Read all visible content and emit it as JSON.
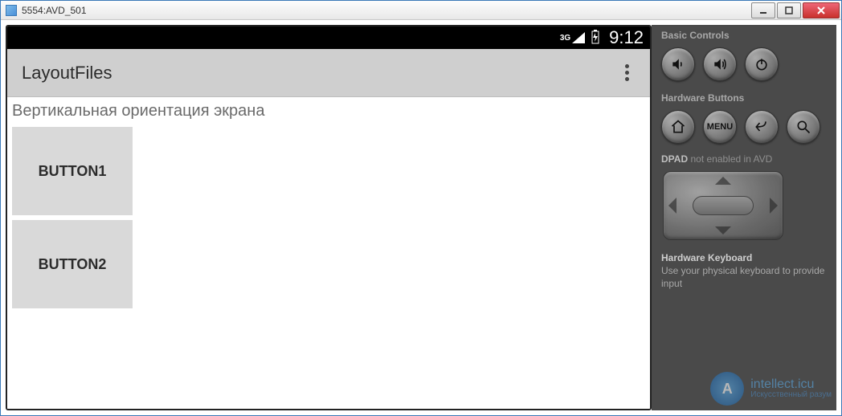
{
  "window": {
    "title": "5554:AVD_501"
  },
  "statusbar": {
    "network": "3G",
    "clock": "9:12"
  },
  "actionbar": {
    "title": "LayoutFiles"
  },
  "content": {
    "textview": "Вертикальная ориентация экрана",
    "button1": "BUTTON1",
    "button2": "BUTTON2"
  },
  "sidebar": {
    "basic_controls_heading": "Basic Controls",
    "hardware_buttons_heading": "Hardware Buttons",
    "menu_button_label": "MENU",
    "dpad_label": "DPAD",
    "dpad_note": "not enabled in AVD",
    "keyboard_heading": "Hardware Keyboard",
    "keyboard_note": "Use your physical keyboard to provide input"
  },
  "watermark": {
    "brand": "intellect.icu",
    "subtitle": "Искусственный разум",
    "logo_letters": "A"
  }
}
